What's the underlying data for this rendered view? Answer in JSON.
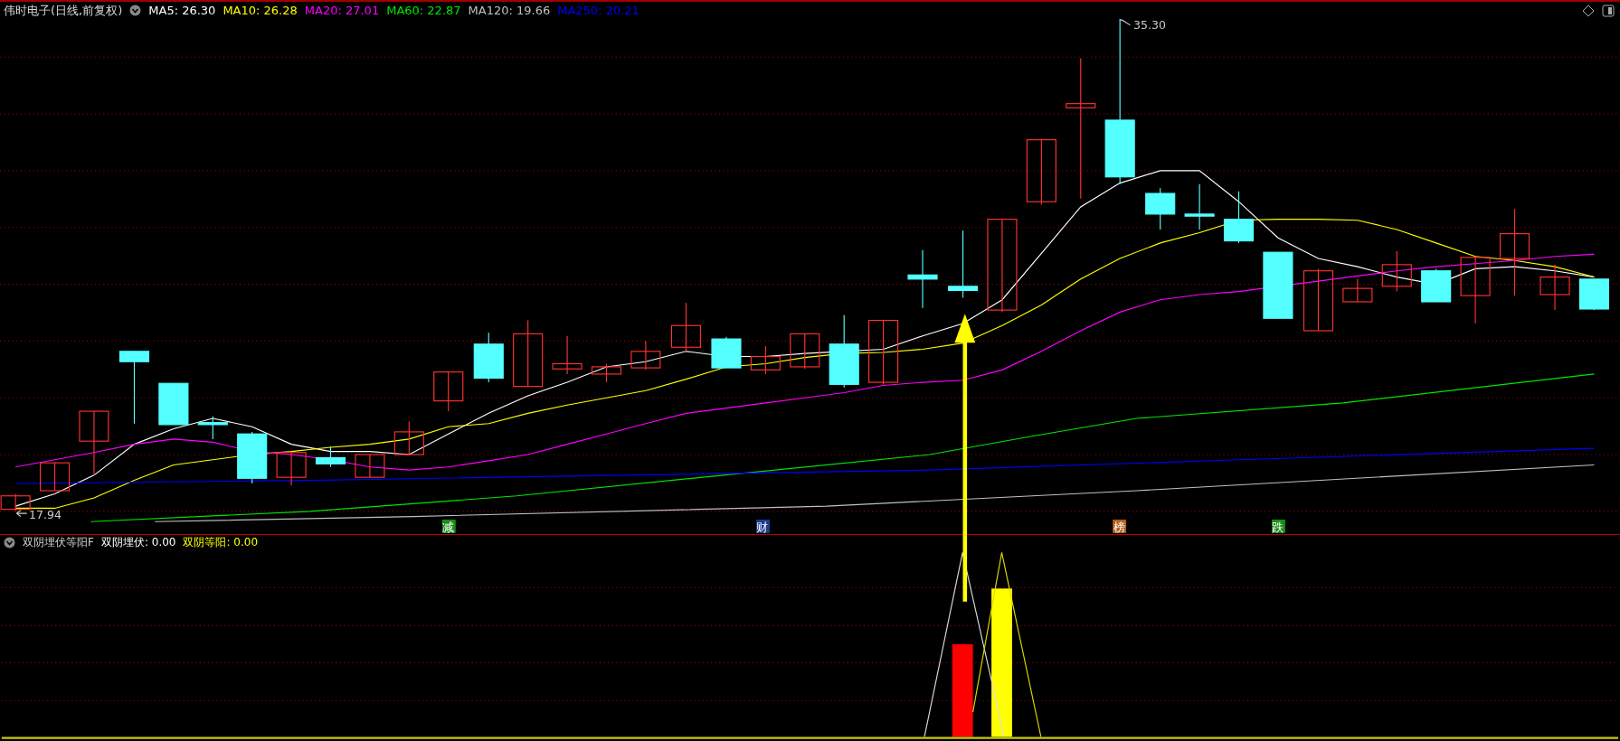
{
  "main_chart": {
    "title": "伟时电子(日线,前复权)",
    "moving_averages": [
      {
        "label": "MA5: 26.30",
        "color": "#ffffff"
      },
      {
        "label": "MA10: 26.28",
        "color": "#ffff00"
      },
      {
        "label": "MA20: 27.01",
        "color": "#ff00ff"
      },
      {
        "label": "MA60: 22.87",
        "color": "#00e600"
      },
      {
        "label": "MA120: 19.66",
        "color": "#c0c0c0"
      },
      {
        "label": "MA250: 20.21",
        "color": "#0000ff"
      }
    ],
    "high_label": "35.30",
    "low_label": "17.94",
    "markers": [
      {
        "text": "减",
        "color": "#1a8c1a"
      },
      {
        "text": "财",
        "color": "#1c3c8c"
      },
      {
        "text": "榜",
        "color": "#b4601a"
      },
      {
        "text": "跌",
        "color": "#1a8c1a"
      }
    ]
  },
  "indicator": {
    "title": "双阴埋伏等阳F",
    "values": [
      {
        "label": "双阴埋伏: 0.00",
        "color": "#ffffff"
      },
      {
        "label": "双阴等阳: 0.00",
        "color": "#ffff00"
      }
    ]
  }
}
